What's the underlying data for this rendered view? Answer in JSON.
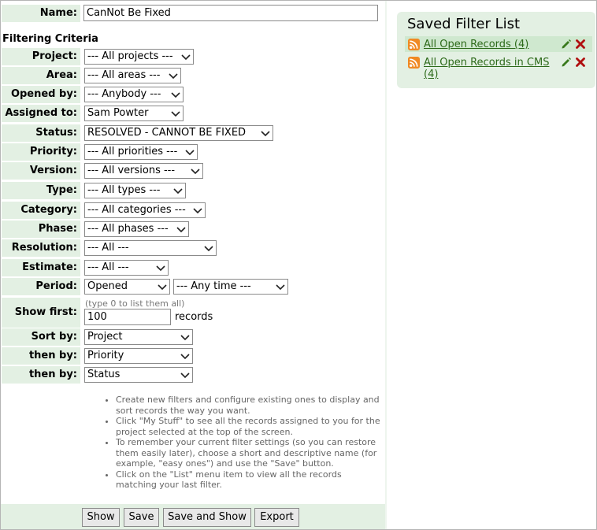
{
  "form": {
    "name_label": "Name:",
    "name_value": "CanNot Be Fixed",
    "section_title": "Filtering Criteria",
    "fields": [
      {
        "label": "Project:",
        "value": "--- All projects ---"
      },
      {
        "label": "Area:",
        "value": "--- All areas ---"
      },
      {
        "label": "Opened by:",
        "value": "--- Anybody ---"
      },
      {
        "label": "Assigned to:",
        "value": "Sam Powter"
      },
      {
        "label": "Status:",
        "value": "RESOLVED - CANNOT BE FIXED"
      },
      {
        "label": "Priority:",
        "value": "--- All priorities ---"
      },
      {
        "label": "Version:",
        "value": "--- All versions ---"
      },
      {
        "label": "Type:",
        "value": "--- All types ---"
      },
      {
        "label": "Category:",
        "value": "--- All categories ---"
      },
      {
        "label": "Phase:",
        "value": "--- All phases ---"
      },
      {
        "label": "Resolution:",
        "value": "--- All ---"
      },
      {
        "label": "Estimate:",
        "value": "--- All ---"
      }
    ],
    "period": {
      "label": "Period:",
      "value": "Opened",
      "range_value": "--- Any time ---"
    },
    "show_first": {
      "label": "Show first:",
      "hint": "(type 0 to list them all)",
      "value": "100",
      "suffix": "records"
    },
    "sort": [
      {
        "label": "Sort by:",
        "value": "Project"
      },
      {
        "label": "then by:",
        "value": "Priority"
      },
      {
        "label": "then by:",
        "value": "Status"
      }
    ]
  },
  "help": [
    "Create new filters and configure existing ones to display and sort records the way you want.",
    "Click \"My Stuff\" to see all the records assigned to you for the project selected at the top of the screen.",
    "To remember your current filter settings (so you can restore them easily later), choose a short and descriptive name (for example, \"easy ones\") and use the \"Save\" button.",
    "Click on the \"List\" menu item to view all the records matching your last filter."
  ],
  "buttons": {
    "show": "Show",
    "save": "Save",
    "save_and_show": "Save and Show",
    "export": "Export"
  },
  "saved_filters": {
    "title": "Saved Filter List",
    "items": [
      {
        "label": "All Open Records (4)",
        "icon": "rss-icon"
      },
      {
        "label_line1": "All Open Records in CMS",
        "label_line2": "(4)",
        "icon": "rss-icon"
      }
    ]
  },
  "colors": {
    "label_bg": "#e3f0e3",
    "link": "#2d6a1a",
    "edit": "#3a7a1e",
    "delete": "#b01010",
    "rss": "#f08a24"
  }
}
